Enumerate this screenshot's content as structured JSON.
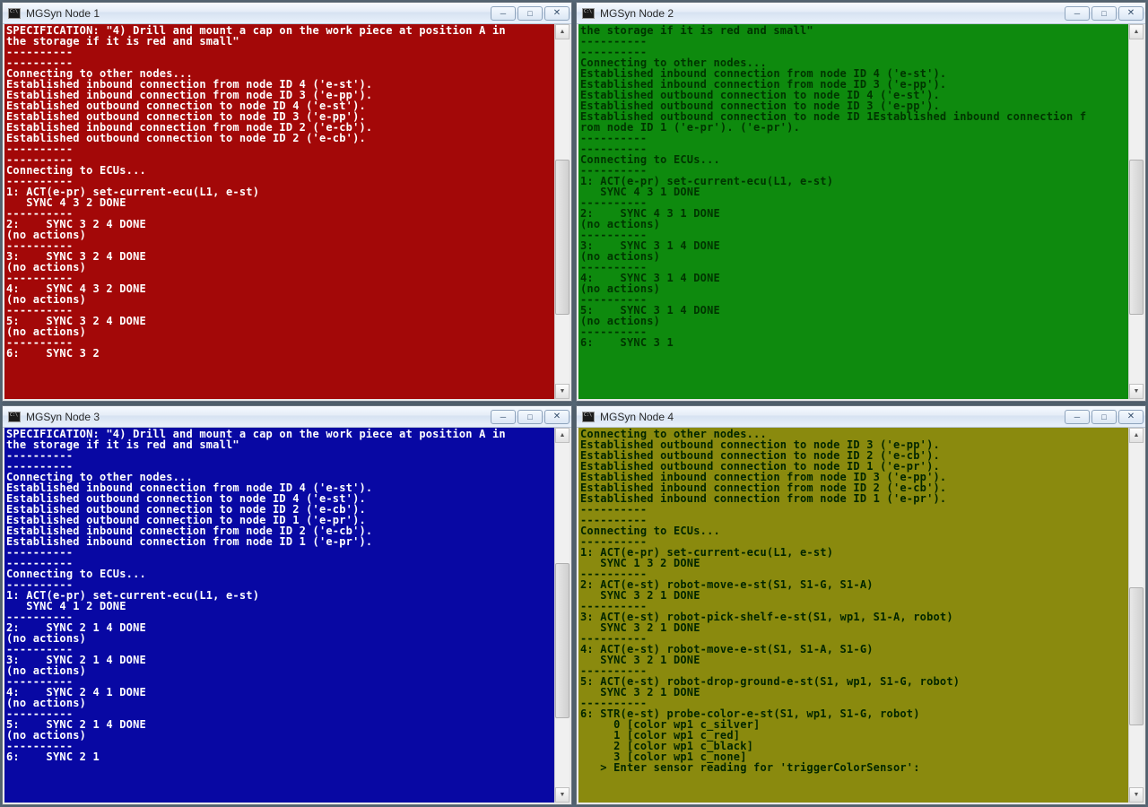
{
  "windows": [
    {
      "id": "node1",
      "title": "MGSyn Node 1",
      "minTooltip": "Minimize",
      "maxTooltip": "Maximize",
      "closeTooltip": "Close",
      "scrollbarThumb": {
        "top": "35%",
        "height": "45%"
      },
      "content": "SPECIFICATION: \"4) Drill and mount a cap on the work piece at position A in\nthe storage if it is red and small\"\n----------\n----------\nConnecting to other nodes...\nEstablished inbound connection from node ID 4 ('e-st').\nEstablished inbound connection from node ID 3 ('e-pp').\nEstablished outbound connection to node ID 4 ('e-st').\nEstablished outbound connection to node ID 3 ('e-pp').\nEstablished inbound connection from node ID 2 ('e-cb').\nEstablished outbound connection to node ID 2 ('e-cb').\n----------\n----------\nConnecting to ECUs...\n----------\n1: ACT(e-pr) set-current-ecu(L1, e-st)\n   SYNC 4 3 2 DONE\n----------\n2:    SYNC 3 2 4 DONE\n(no actions)\n----------\n3:    SYNC 3 2 4 DONE\n(no actions)\n----------\n4:    SYNC 4 3 2 DONE\n(no actions)\n----------\n5:    SYNC 3 2 4 DONE\n(no actions)\n----------\n6:    SYNC 3 2"
    },
    {
      "id": "node2",
      "title": "MGSyn Node 2",
      "minTooltip": "Minimize",
      "maxTooltip": "Maximize",
      "closeTooltip": "Close",
      "scrollbarThumb": {
        "top": "35%",
        "height": "45%"
      },
      "content": "the storage if it is red and small\"\n----------\n----------\nConnecting to other nodes...\nEstablished inbound connection from node ID 4 ('e-st').\nEstablished inbound connection from node ID 3 ('e-pp').\nEstablished outbound connection to node ID 4 ('e-st').\nEstablished outbound connection to node ID 3 ('e-pp').\nEstablished outbound connection to node ID 1Established inbound connection f\nrom node ID 1 ('e-pr'). ('e-pr').\n----------\n----------\nConnecting to ECUs...\n----------\n1: ACT(e-pr) set-current-ecu(L1, e-st)\n   SYNC 4 3 1 DONE\n----------\n2:    SYNC 4 3 1 DONE\n(no actions)\n----------\n3:    SYNC 3 1 4 DONE\n(no actions)\n----------\n4:    SYNC 3 1 4 DONE\n(no actions)\n----------\n5:    SYNC 3 1 4 DONE\n(no actions)\n----------\n6:    SYNC 3 1"
    },
    {
      "id": "node3",
      "title": "MGSyn Node 3",
      "minTooltip": "Minimize",
      "maxTooltip": "Maximize",
      "closeTooltip": "Close",
      "scrollbarThumb": {
        "top": "35%",
        "height": "45%"
      },
      "content": "SPECIFICATION: \"4) Drill and mount a cap on the work piece at position A in\nthe storage if it is red and small\"\n----------\n----------\nConnecting to other nodes...\nEstablished inbound connection from node ID 4 ('e-st').\nEstablished outbound connection to node ID 4 ('e-st').\nEstablished outbound connection to node ID 2 ('e-cb').\nEstablished outbound connection to node ID 1 ('e-pr').\nEstablished inbound connection from node ID 2 ('e-cb').\nEstablished inbound connection from node ID 1 ('e-pr').\n----------\n----------\nConnecting to ECUs...\n----------\n1: ACT(e-pr) set-current-ecu(L1, e-st)\n   SYNC 4 1 2 DONE\n----------\n2:    SYNC 2 1 4 DONE\n(no actions)\n----------\n3:    SYNC 2 1 4 DONE\n(no actions)\n----------\n4:    SYNC 2 4 1 DONE\n(no actions)\n----------\n5:    SYNC 2 1 4 DONE\n(no actions)\n----------\n6:    SYNC 2 1"
    },
    {
      "id": "node4",
      "title": "MGSyn Node 4",
      "minTooltip": "Minimize",
      "maxTooltip": "Maximize",
      "closeTooltip": "Close",
      "scrollbarThumb": {
        "top": "42%",
        "height": "40%"
      },
      "content": "Connecting to other nodes...\nEstablished outbound connection to node ID 3 ('e-pp').\nEstablished outbound connection to node ID 2 ('e-cb').\nEstablished outbound connection to node ID 1 ('e-pr').\nEstablished inbound connection from node ID 3 ('e-pp').\nEstablished inbound connection from node ID 2 ('e-cb').\nEstablished inbound connection from node ID 1 ('e-pr').\n----------\n----------\nConnecting to ECUs...\n----------\n1: ACT(e-pr) set-current-ecu(L1, e-st)\n   SYNC 1 3 2 DONE\n----------\n2: ACT(e-st) robot-move-e-st(S1, S1-G, S1-A)\n   SYNC 3 2 1 DONE\n----------\n3: ACT(e-st) robot-pick-shelf-e-st(S1, wp1, S1-A, robot)\n   SYNC 3 2 1 DONE\n----------\n4: ACT(e-st) robot-move-e-st(S1, S1-A, S1-G)\n   SYNC 3 2 1 DONE\n----------\n5: ACT(e-st) robot-drop-ground-e-st(S1, wp1, S1-G, robot)\n   SYNC 3 2 1 DONE\n----------\n6: STR(e-st) probe-color-e-st(S1, wp1, S1-G, robot)\n     0 [color wp1 c_silver]\n     1 [color wp1 c_red]\n     2 [color wp1 c_black]\n     3 [color wp1 c_none]\n   > Enter sensor reading for 'triggerColorSensor':"
    }
  ]
}
